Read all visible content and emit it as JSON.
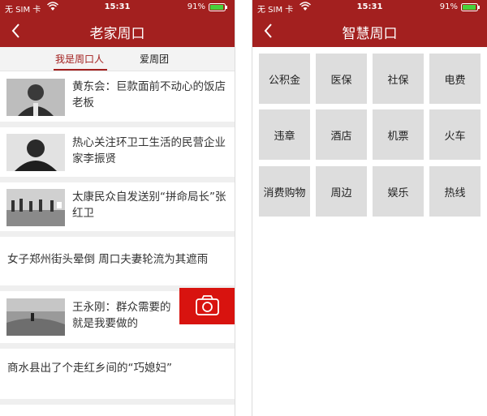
{
  "left": {
    "status": {
      "carrier": "无 SIM 卡",
      "time": "15:31",
      "battery": "91%"
    },
    "nav": {
      "title": "老家周口"
    },
    "tabs": [
      {
        "label": "我是周口人",
        "active": true
      },
      {
        "label": "爱周团",
        "active": false
      }
    ],
    "news": [
      {
        "title": "黄东会：巨款面前不动心的饭店老板",
        "thumb": "portrait-photo"
      },
      {
        "title": "热心关注环卫工生活的民营企业家李振贤",
        "thumb": "portrait-photo"
      },
      {
        "title": "太康民众自发送别“拼命局长”张红卫",
        "thumb": "crowd-photo"
      },
      {
        "title": "女子郑州街头晕倒 周口夫妻轮流为其遮雨",
        "thumb": null
      },
      {
        "title": "王永刚：群众需要的就是我要做的",
        "thumb": "flood-photo"
      },
      {
        "title": "商水县出了个走红乡间的“巧媳妇”",
        "thumb": null
      }
    ]
  },
  "right": {
    "status": {
      "carrier": "无 SIM 卡",
      "time": "15:31",
      "battery": "91%"
    },
    "nav": {
      "title": "智慧周口"
    },
    "services": [
      {
        "label": "公积金"
      },
      {
        "label": "医保"
      },
      {
        "label": "社保"
      },
      {
        "label": "电费"
      },
      {
        "label": "违章"
      },
      {
        "label": "酒店"
      },
      {
        "label": "机票"
      },
      {
        "label": "火车"
      },
      {
        "label": "消费购物"
      },
      {
        "label": "周边"
      },
      {
        "label": "娱乐"
      },
      {
        "label": "热线"
      }
    ]
  },
  "colors": {
    "brand": "#a3201f",
    "camera": "#d8130f",
    "tile": "#dddddd"
  }
}
